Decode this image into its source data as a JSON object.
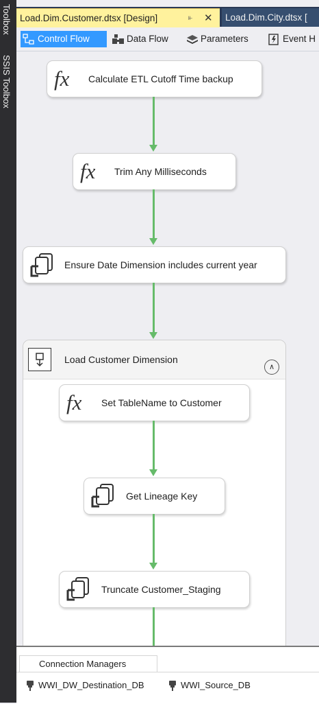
{
  "sidebar": {
    "toolbox": "Toolbox",
    "ssis_toolbox": "SSIS Toolbox"
  },
  "tabs": [
    {
      "title": "Load.Dim.Customer.dtsx [Design]",
      "active": true
    },
    {
      "title": "Load.Dim.City.dtsx [",
      "active": false
    }
  ],
  "designer_tabs": [
    {
      "label": "Control Flow",
      "icon": "control-flow-icon",
      "active": true
    },
    {
      "label": "Data Flow",
      "icon": "data-flow-icon",
      "active": false
    },
    {
      "label": "Parameters",
      "icon": "parameters-icon",
      "active": false
    },
    {
      "label": "Event H",
      "icon": "event-handlers-icon",
      "active": false
    }
  ],
  "tasks": [
    {
      "label": "Calculate ETL Cutoff Time backup",
      "icon": "fx-icon"
    },
    {
      "label": "Trim Any Milliseconds",
      "icon": "fx-icon"
    },
    {
      "label": "Ensure Date Dimension includes current year",
      "icon": "sql-task-icon"
    }
  ],
  "container": {
    "label": "Load Customer Dimension",
    "tasks": [
      {
        "label": "Set TableName to Customer",
        "icon": "fx-icon"
      },
      {
        "label": "Get Lineage Key",
        "icon": "sql-task-icon"
      },
      {
        "label": "Truncate Customer_Staging",
        "icon": "sql-task-icon"
      }
    ]
  },
  "connection_managers": {
    "title": "Connection Managers",
    "items": [
      "WWI_DW_Destination_DB",
      "WWI_Source_DB"
    ]
  },
  "colors": {
    "active_tab": "#fff29d",
    "tab_bar": "#293955",
    "selected_subtab": "#3399ff",
    "precedence_arrow": "#66bb6a"
  }
}
